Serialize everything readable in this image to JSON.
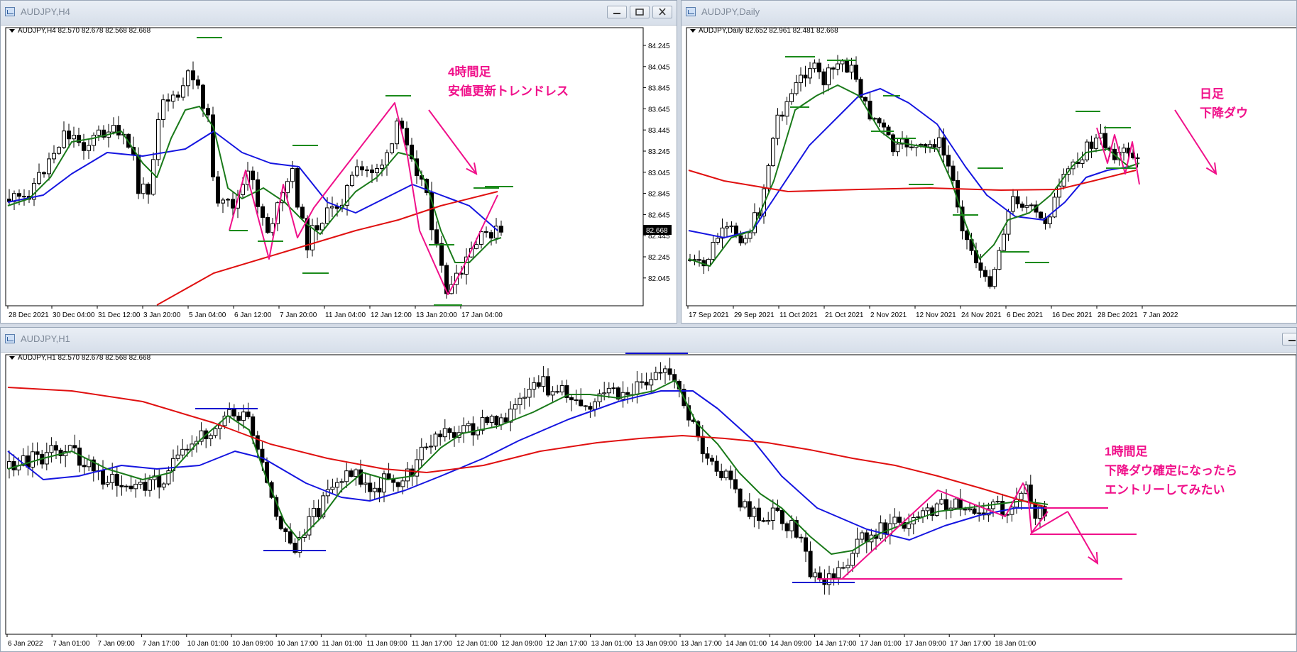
{
  "colors": {
    "candle_up": "#ffffff",
    "candle_down": "#000000",
    "ma_green": "#1a7a1a",
    "ma_blue": "#1515e0",
    "ma_red": "#e01010",
    "annotation_pink": "#f0108a",
    "level_green": "#1a8a1a",
    "level_blue": "#1010d0",
    "price_tag_bg": "#000000"
  },
  "windows": [
    {
      "id": "h4",
      "title": "AUDJPY,H4",
      "header": "AUDJPY,H4  82.570 82.678 82.568 82.668",
      "price_tag": "82.668",
      "y_ticks": [
        "84.245",
        "84.045",
        "83.845",
        "83.645",
        "83.445",
        "83.245",
        "83.045",
        "82.845",
        "82.645",
        "82.445",
        "82.245",
        "82.045"
      ],
      "x_ticks": [
        "28 Dec 2021",
        "30 Dec 04:00",
        "31 Dec 12:00",
        "3 Jan 20:00",
        "5 Jan 04:00",
        "6 Jan 12:00",
        "7 Jan 20:00",
        "11 Jan 04:00",
        "12 Jan 12:00",
        "13 Jan 20:00",
        "17 Jan 04:00"
      ],
      "annotation": [
        "4時間足",
        "安値更新トレンドレス"
      ]
    },
    {
      "id": "daily",
      "title": "AUDJPY,Daily",
      "header": "AUDJPY,Daily  82.652 82.961 82.481 82.668",
      "x_ticks": [
        "17 Sep 2021",
        "29 Sep 2021",
        "11 Oct 2021",
        "21 Oct 2021",
        "2 Nov 2021",
        "12 Nov 2021",
        "24 Nov 2021",
        "6 Dec 2021",
        "16 Dec 2021",
        "28 Dec 2021",
        "7 Jan 2022"
      ],
      "annotation": [
        "日足",
        "下降ダウ"
      ]
    },
    {
      "id": "h1",
      "title": "AUDJPY,H1",
      "header": "AUDJPY,H1  82.570 82.678 82.568 82.668",
      "x_ticks": [
        "6 Jan 2022",
        "7 Jan 01:00",
        "7 Jan 09:00",
        "7 Jan 17:00",
        "10 Jan 01:00",
        "10 Jan 09:00",
        "10 Jan 17:00",
        "11 Jan 01:00",
        "11 Jan 09:00",
        "11 Jan 17:00",
        "12 Jan 01:00",
        "12 Jan 09:00",
        "12 Jan 17:00",
        "13 Jan 01:00",
        "13 Jan 09:00",
        "13 Jan 17:00",
        "14 Jan 01:00",
        "14 Jan 09:00",
        "14 Jan 17:00",
        "17 Jan 01:00",
        "17 Jan 09:00",
        "17 Jan 17:00",
        "18 Jan 01:00"
      ],
      "annotation": [
        "1時間足",
        "下降ダウ確定になったら",
        "エントリーしてみたい"
      ]
    }
  ]
}
